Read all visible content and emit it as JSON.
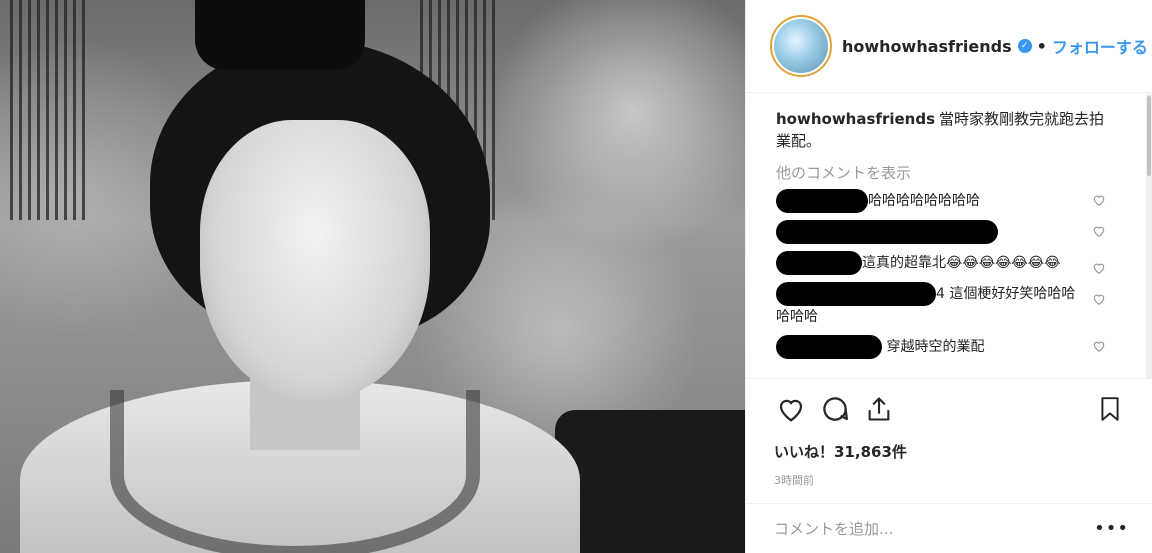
{
  "header": {
    "username": "howhowhasfriends",
    "separator": "•",
    "follow_label": "フォローする",
    "verified_glyph": "✓"
  },
  "caption": {
    "username": "howhowhasfriends",
    "text": "當時家教剛教完就跑去拍業配。"
  },
  "view_more_comments": "他のコメントを表示",
  "comments": [
    {
      "text": "哈哈哈哈哈哈哈哈"
    },
    {
      "text": ""
    },
    {
      "text": "這真的超靠北😂😂😂😂😂😂😂"
    },
    {
      "text": "4 這個梗好好笑哈哈哈哈哈哈"
    },
    {
      "text": "穿越時空的業配"
    }
  ],
  "likes": "いいね！31,863件",
  "timestamp": "3時間前",
  "add_comment": {
    "placeholder": "コメントを追加...",
    "more_label": "•••"
  },
  "icons": [
    "heart-icon",
    "comment-icon",
    "share-icon",
    "bookmark-icon"
  ],
  "colors": {
    "accent": "#3897f0",
    "muted": "#999999",
    "text": "#262626",
    "border": "#efefef"
  }
}
